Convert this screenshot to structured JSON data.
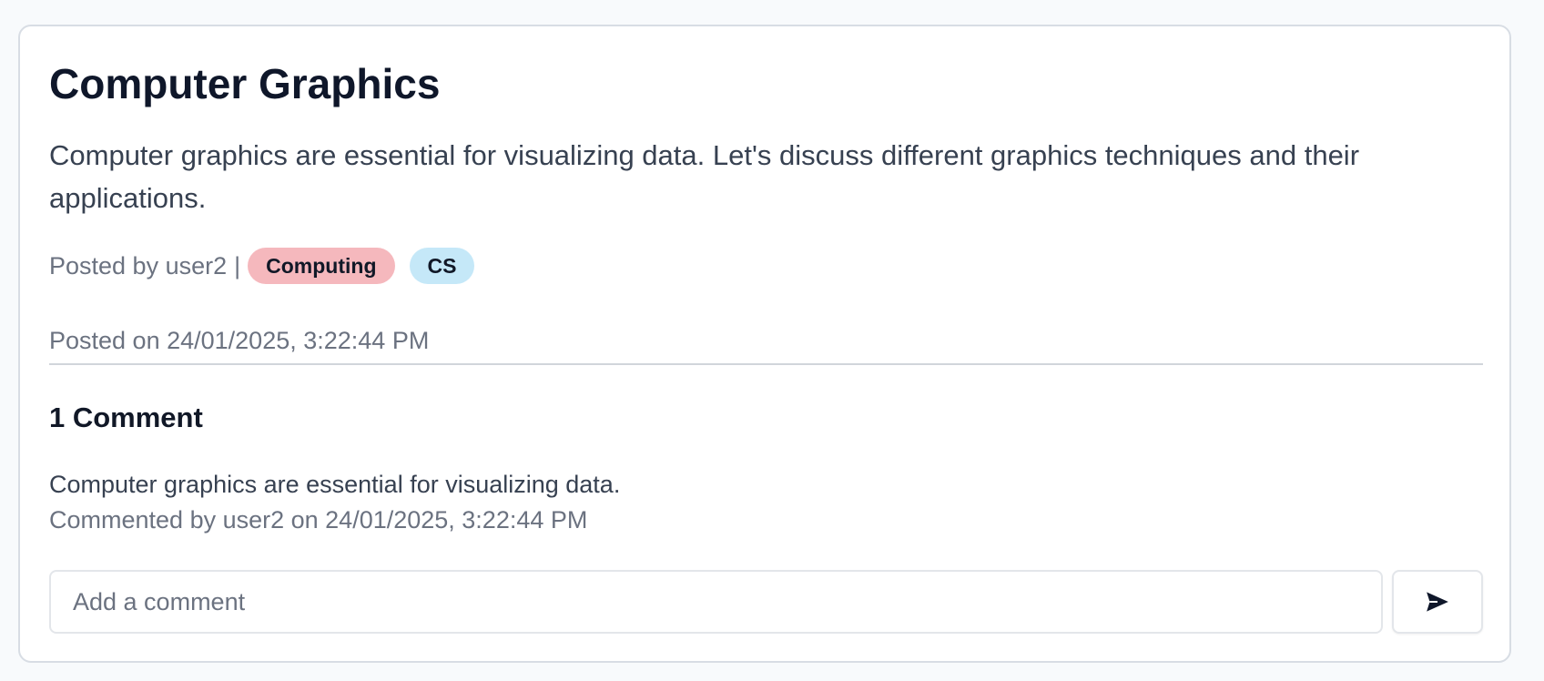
{
  "post": {
    "title": "Computer Graphics",
    "body": "Computer graphics are essential for visualizing data. Let's discuss different graphics techniques and their applications.",
    "posted_by": "Posted by user2",
    "separator": "|",
    "tags": [
      {
        "label": "Computing",
        "color": "#f5b8bd"
      },
      {
        "label": "CS",
        "color": "#c5e8f8"
      }
    ],
    "posted_on": "Posted on 24/01/2025, 3:22:44 PM"
  },
  "comments": {
    "heading": "1 Comment",
    "items": [
      {
        "text": "Computer graphics are essential for visualizing data.",
        "meta": "Commented by user2 on 24/01/2025, 3:22:44 PM"
      }
    ]
  },
  "comment_form": {
    "placeholder": "Add a comment",
    "value": "",
    "send_icon": "send-icon"
  }
}
